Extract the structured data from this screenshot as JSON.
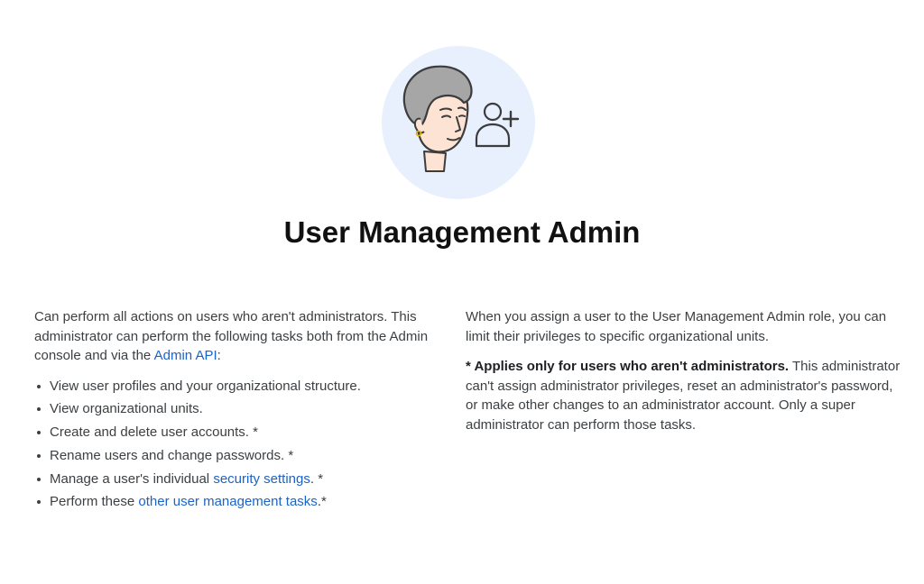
{
  "hero": {
    "icon": "person-with-add-user-icon",
    "circle_color": "#e8f0fe",
    "hair_color": "#a6a6a6",
    "skin_color": "#fde3d4",
    "outline_color": "#3c3c3c"
  },
  "title": "User Management Admin",
  "left": {
    "intro_part1": "Can perform all actions on users who aren't administrators. This administrator can perform the following tasks both from the Admin console and via the ",
    "intro_link": "Admin API",
    "intro_part2": ":",
    "tasks": [
      {
        "text": "View user profiles and your organizational structure."
      },
      {
        "text": "View organizational units."
      },
      {
        "text": "Create and delete user accounts. *"
      },
      {
        "text": "Rename users and change passwords. *"
      },
      {
        "prefix": "Manage a user's individual ",
        "link": "security settings",
        "suffix": ". *"
      },
      {
        "prefix": "Perform these ",
        "link": "other user management tasks",
        "suffix": ".*"
      }
    ]
  },
  "right": {
    "para1": "When you assign a user to the User Management Admin role, you can limit their privileges to specific organizational units.",
    "note_bold": "* Applies only for users who aren't administrators.",
    "note_rest": " This administrator can't assign administrator privileges, reset an administrator's password, or make other changes to an administrator account. Only a super administrator can perform those tasks."
  },
  "colors": {
    "link": "#1a63c9",
    "text": "#3c4043",
    "title": "#111111"
  }
}
